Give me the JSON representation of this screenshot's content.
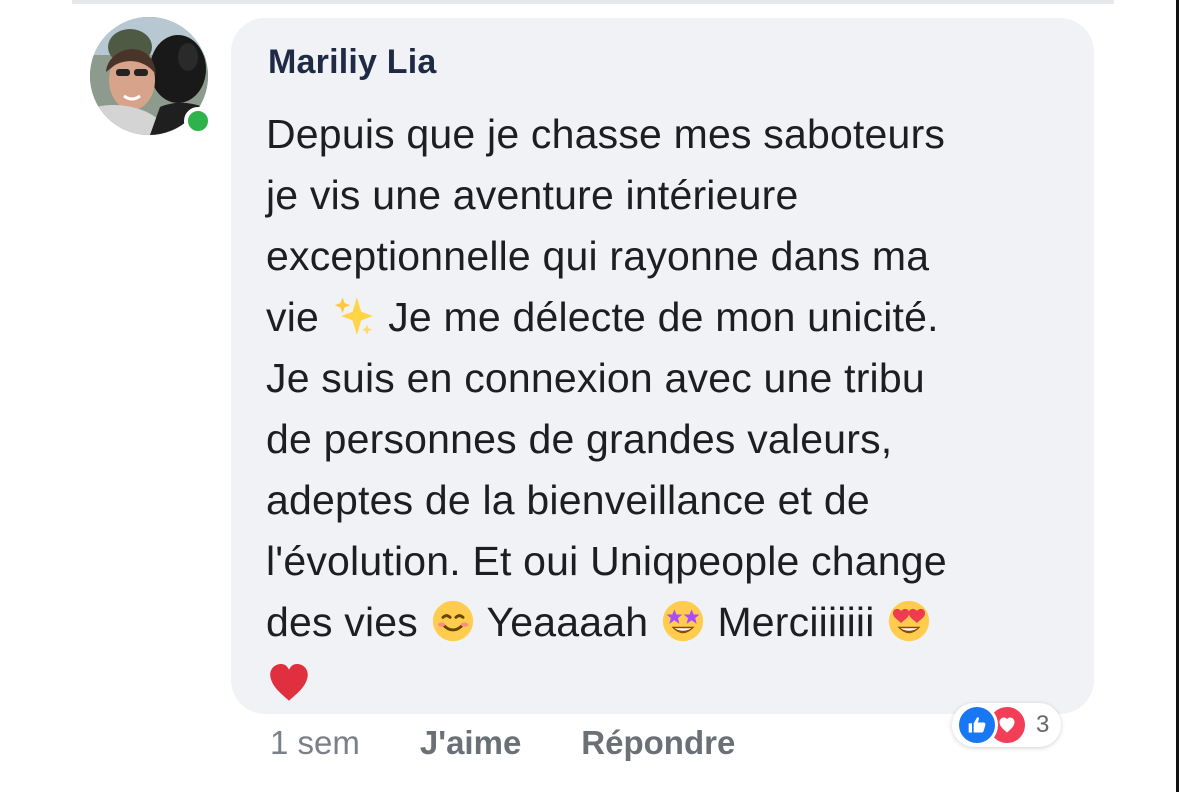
{
  "comment": {
    "author": "Mariliy Lia",
    "lines": [
      "Depuis que je chasse mes saboteurs",
      "je vis une aventure intérieure",
      "exceptionnelle qui rayonne dans ma",
      "vie ",
      " Je me délecte de mon unicité.",
      "Je suis en connexion avec une tribu",
      "de personnes de grandes valeurs,",
      "adeptes de la bienveillance et de",
      "l'évolution. Et oui Uniqpeople change",
      "des vies ",
      " Yeaaaah ",
      " Merciiiiiii "
    ],
    "emojis": [
      "sparkles-emoji",
      "smiling-face-emoji",
      "star-struck-emoji",
      "heart-eyes-emoji",
      "red-heart-emoji"
    ]
  },
  "meta": {
    "time": "1 sem",
    "like_label": "J'aime",
    "reply_label": "Répondre"
  },
  "reactions": {
    "icons": [
      "like-icon",
      "love-icon"
    ],
    "count": "3",
    "colors": {
      "like": "#1877f2",
      "love": "#f33e58"
    }
  },
  "status": {
    "online_color": "#2fb24b"
  }
}
